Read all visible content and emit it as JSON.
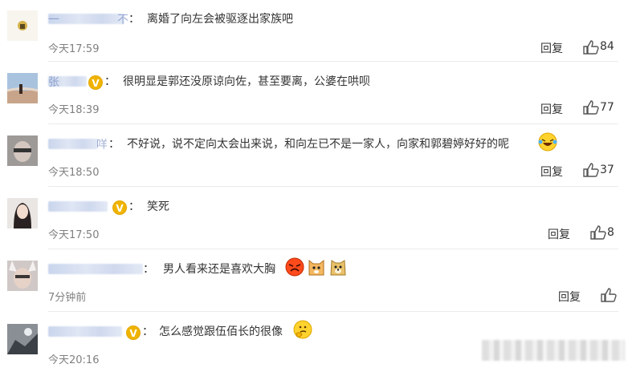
{
  "comments": [
    {
      "name_tail": "一",
      "name_end": "不",
      "text": "离婚了向左会被驱逐出家族吧",
      "time": "今天17:59",
      "reply": "回复",
      "likes": "84",
      "verified": false
    },
    {
      "name_tail": "张",
      "name_end": "",
      "text": "很明显是郭还没原谅向佐，甚至要离，公婆在哄呗",
      "time": "今天18:39",
      "reply": "回复",
      "likes": "77",
      "verified": true
    },
    {
      "name_tail": "",
      "name_end": "咩",
      "text": "不好说，说不定向太会出来说，和向左已不是一家人，向家和郭碧婷好好的呢",
      "time": "今天18:50",
      "reply": "回复",
      "likes": "37",
      "verified": false
    },
    {
      "name_tail": "",
      "name_end": "",
      "text": "笑死",
      "time": "今天17:50",
      "reply": "回复",
      "likes": "8",
      "verified": true
    },
    {
      "name_tail": "",
      "name_end": "",
      "text": "男人看来还是喜欢大胸",
      "time": "7分钟前",
      "reply": "回复",
      "likes": "",
      "verified": false
    },
    {
      "name_tail": "",
      "name_end": "",
      "text": "怎么感觉跟伍佰长的很像",
      "time": "今天20:16",
      "reply": "",
      "likes": "",
      "verified": true
    }
  ],
  "colon": "：",
  "icons": {
    "like": "thumbs-up-icon",
    "verified": "verified-v-icon"
  },
  "colors": {
    "text": "#333333",
    "time": "#808080",
    "verified": "#f0b400",
    "name": "#5a75b5"
  }
}
